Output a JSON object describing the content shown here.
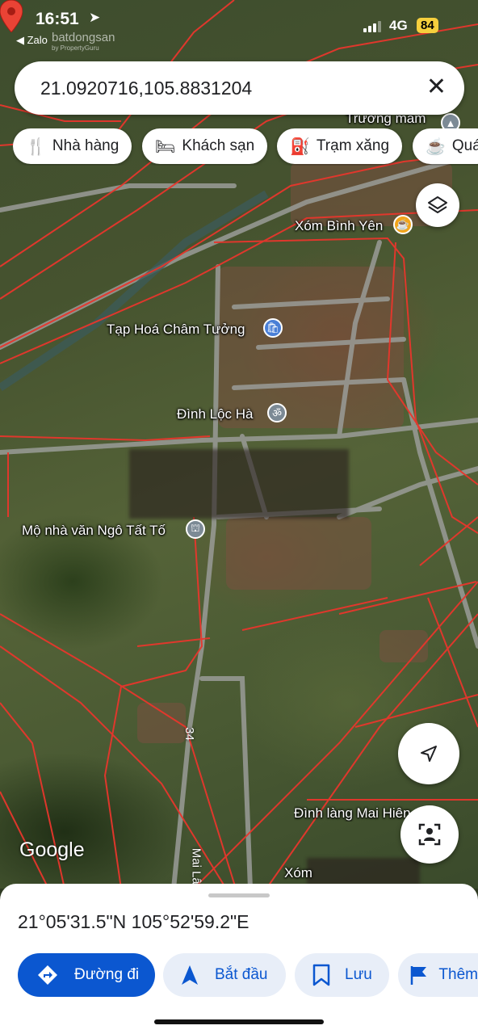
{
  "status_bar": {
    "time": "16:51",
    "back_app": "◀ Zalo",
    "network": "4G",
    "battery": "84",
    "watermark": "batdongsan",
    "watermark_sub": "by PropertyGuru"
  },
  "search": {
    "query": "21.0920716,105.8831204",
    "close_icon": "close-icon"
  },
  "chips": [
    {
      "label": "Nhà hàng",
      "icon": "restaurant-icon"
    },
    {
      "label": "Khách sạn",
      "icon": "hotel-icon"
    },
    {
      "label": "Trạm xăng",
      "icon": "gas-station-icon"
    },
    {
      "label": "Quá",
      "icon": "coffee-icon"
    }
  ],
  "map": {
    "labels": {
      "truong_mam": "Trường mầm",
      "xom_binh_yen": "Xóm Bình Yên",
      "tap_hoa": "Tạp Hoá Châm Tưởng",
      "dinh_loc_ha": "Đình Lộc Hà",
      "mo_nha_van": "Mộ nhà văn Ngô Tất Tố",
      "dinh_lang_mai": "Đình làng Mai Hiên",
      "xom_partial": "Xóm",
      "road_name": "Mai Lâm",
      "road_number": "34",
      "logo": "Google"
    },
    "pin_color": "#ea4335",
    "boundary_color": "#e8362c"
  },
  "bottom_sheet": {
    "coordinates": "21°05'31.5\"N 105°52'59.2\"E",
    "actions": [
      {
        "label": "Đường đi",
        "icon": "directions-icon",
        "primary": true
      },
      {
        "label": "Bắt đầu",
        "icon": "navigation-arrow-icon",
        "primary": false
      },
      {
        "label": "Lưu",
        "icon": "bookmark-icon",
        "primary": false
      },
      {
        "label": "Thêm",
        "icon": "flag-icon",
        "primary": false
      }
    ]
  },
  "colors": {
    "accent": "#0b57d0",
    "accent_light": "#e8eef8",
    "pin": "#ea4335"
  }
}
